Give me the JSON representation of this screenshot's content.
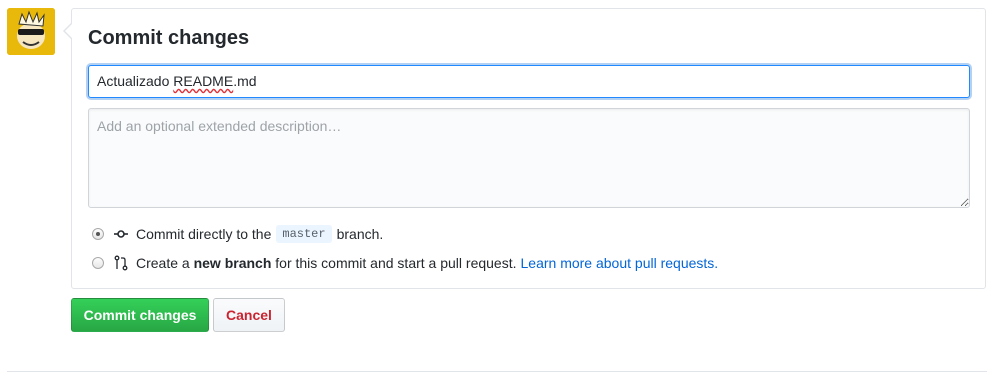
{
  "form": {
    "title": "Commit changes",
    "summary_value_prefix": "Actualizado ",
    "summary_value_misspelled": "README",
    "summary_value_suffix": ".md",
    "description_placeholder": "Add an optional extended description…"
  },
  "options": {
    "direct": {
      "checked": true,
      "text_before": "Commit directly to the",
      "branch": "master",
      "text_after": "branch.",
      "icon": "git-commit-icon"
    },
    "new_branch": {
      "checked": false,
      "text_before": "Create a",
      "bold": "new branch",
      "text_after": "for this commit and start a pull request.",
      "link": "Learn more about pull requests.",
      "icon": "git-pull-request-icon"
    }
  },
  "buttons": {
    "commit": "Commit changes",
    "cancel": "Cancel"
  },
  "colors": {
    "commit_green": "#28a745",
    "cancel_red": "#cb2431",
    "link_blue": "#0366d6",
    "focus_blue": "#2188ff",
    "avatar_yellow": "#e8b90a"
  }
}
